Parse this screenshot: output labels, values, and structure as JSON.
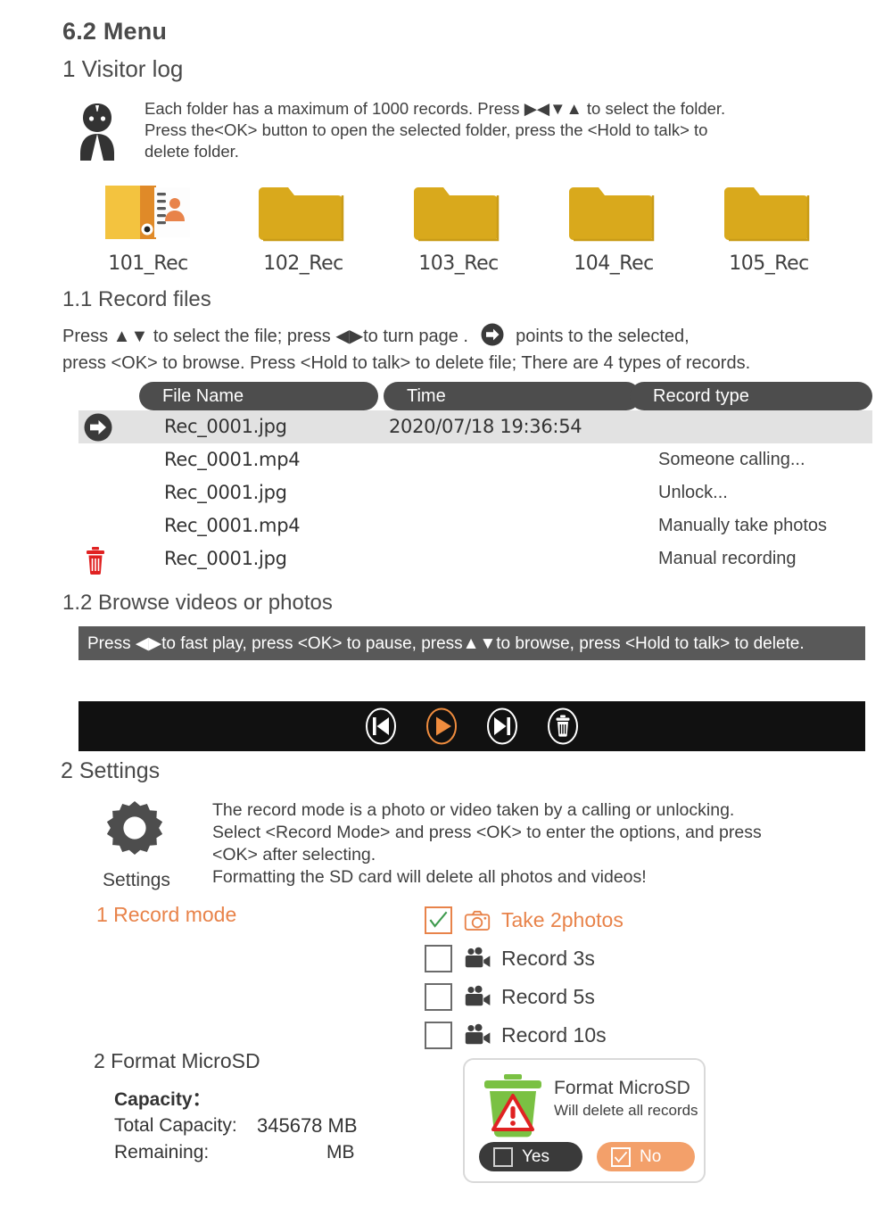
{
  "headings": {
    "section": "6.2 Menu",
    "visitor_log": "1 Visitor log",
    "record_files": "1.1 Record files",
    "browse": "1.2 Browse videos or photos",
    "settings": "2  Settings"
  },
  "visitor_note": {
    "line1": "Each folder has a maximum of 1000 records. Press ▶◀▼▲ to select the folder.",
    "line2": "Press the<OK> button to open the selected folder, press the <Hold to talk> to",
    "line3": "delete folder.",
    "avatar_icon": "person-avatar-icon"
  },
  "folders": [
    {
      "label": "101_Rec",
      "icon": "open-address-book-icon",
      "selected": true
    },
    {
      "label": "102_Rec",
      "icon": "folder-icon",
      "selected": false
    },
    {
      "label": "103_Rec",
      "icon": "folder-icon",
      "selected": false
    },
    {
      "label": "104_Rec",
      "icon": "folder-icon",
      "selected": false
    },
    {
      "label": "105_Rec",
      "icon": "folder-icon",
      "selected": false
    }
  ],
  "record_files": {
    "intro_a": "Press ▲▼ to select the file; press ◀▶to turn page .",
    "intro_b": "points to the selected,",
    "intro_c": "press <OK> to browse. Press <Hold to talk>  to delete file;  There are 4 types of records.",
    "columns": [
      "File Name",
      "Time",
      "Record type"
    ],
    "rows": [
      {
        "lead": "arrow-right-badge-icon",
        "name": "Rec_0001.jpg",
        "time": "2020/07/18  19:36:54",
        "type": "",
        "selected": true
      },
      {
        "lead": "",
        "name": "Rec_0001.mp4",
        "time": "",
        "type": "Someone calling...",
        "selected": false
      },
      {
        "lead": "",
        "name": "Rec_0001.jpg",
        "time": "",
        "type": "Unlock...",
        "selected": false
      },
      {
        "lead": "",
        "name": "Rec_0001.mp4",
        "time": "",
        "type": "Manually take photos",
        "selected": false
      },
      {
        "lead": "trash-red-icon",
        "name": "Rec_0001.jpg",
        "time": "",
        "type": "Manual recording",
        "selected": false
      }
    ]
  },
  "browse": {
    "tip": "Press ◀▶to fast play,  press <OK> to pause, press▲▼to browse,  press <Hold to talk> to delete.",
    "buttons": [
      {
        "name": "previous-button",
        "icon": "skip-previous-icon",
        "color": "#ffffff"
      },
      {
        "name": "play-button",
        "icon": "play-icon",
        "color": "#ef8c3e"
      },
      {
        "name": "next-button",
        "icon": "skip-next-icon",
        "color": "#ffffff"
      },
      {
        "name": "delete-button",
        "icon": "trash-icon",
        "color": "#ffffff"
      }
    ]
  },
  "settings": {
    "icon": "gear-icon",
    "icon_label": "Settings",
    "desc_line1": "The record mode is a photo or video taken by a calling or unlocking.",
    "desc_line2": "Select <Record Mode> and press <OK> to enter the options, and press",
    "desc_line3": " <OK> after selecting.",
    "desc_line4": "Formatting the SD card will delete all photos and videos!",
    "record_mode_title": "1  Record mode",
    "options": [
      {
        "label": "Take 2photos",
        "icon": "photo-camera-icon",
        "checked": true,
        "accent": "#e8834a"
      },
      {
        "label": "Record 3s",
        "icon": "video-camera-icon",
        "checked": false,
        "accent": "#3f3f3f"
      },
      {
        "label": "Record 5s",
        "icon": "video-camera-icon",
        "checked": false,
        "accent": "#3f3f3f"
      },
      {
        "label": "Record 10s",
        "icon": "video-camera-icon",
        "checked": false,
        "accent": "#3f3f3f"
      }
    ]
  },
  "format": {
    "title": "2  Format MicroSD",
    "capacity_label": "Capacity：",
    "total_label": "Total Capacity:",
    "total_value": "345678 MB",
    "remaining_label": "Remaining:",
    "remaining_value": "MB",
    "dialog": {
      "icon": "green-trash-warning-icon",
      "title": "Format MicroSD",
      "subtitle": "Will delete all records",
      "yes_label": "Yes",
      "yes_checked": false,
      "no_label": "No",
      "no_checked": true
    }
  },
  "colors": {
    "folder_yellow": "#d9a91c",
    "accent_orange": "#e8834a",
    "header_gray": "#4d4d4d",
    "tip_gray": "#595959",
    "player_black": "#111111",
    "selected_row": "#e2e2e2",
    "trash_red": "#e02222",
    "bin_green": "#7ac143"
  }
}
